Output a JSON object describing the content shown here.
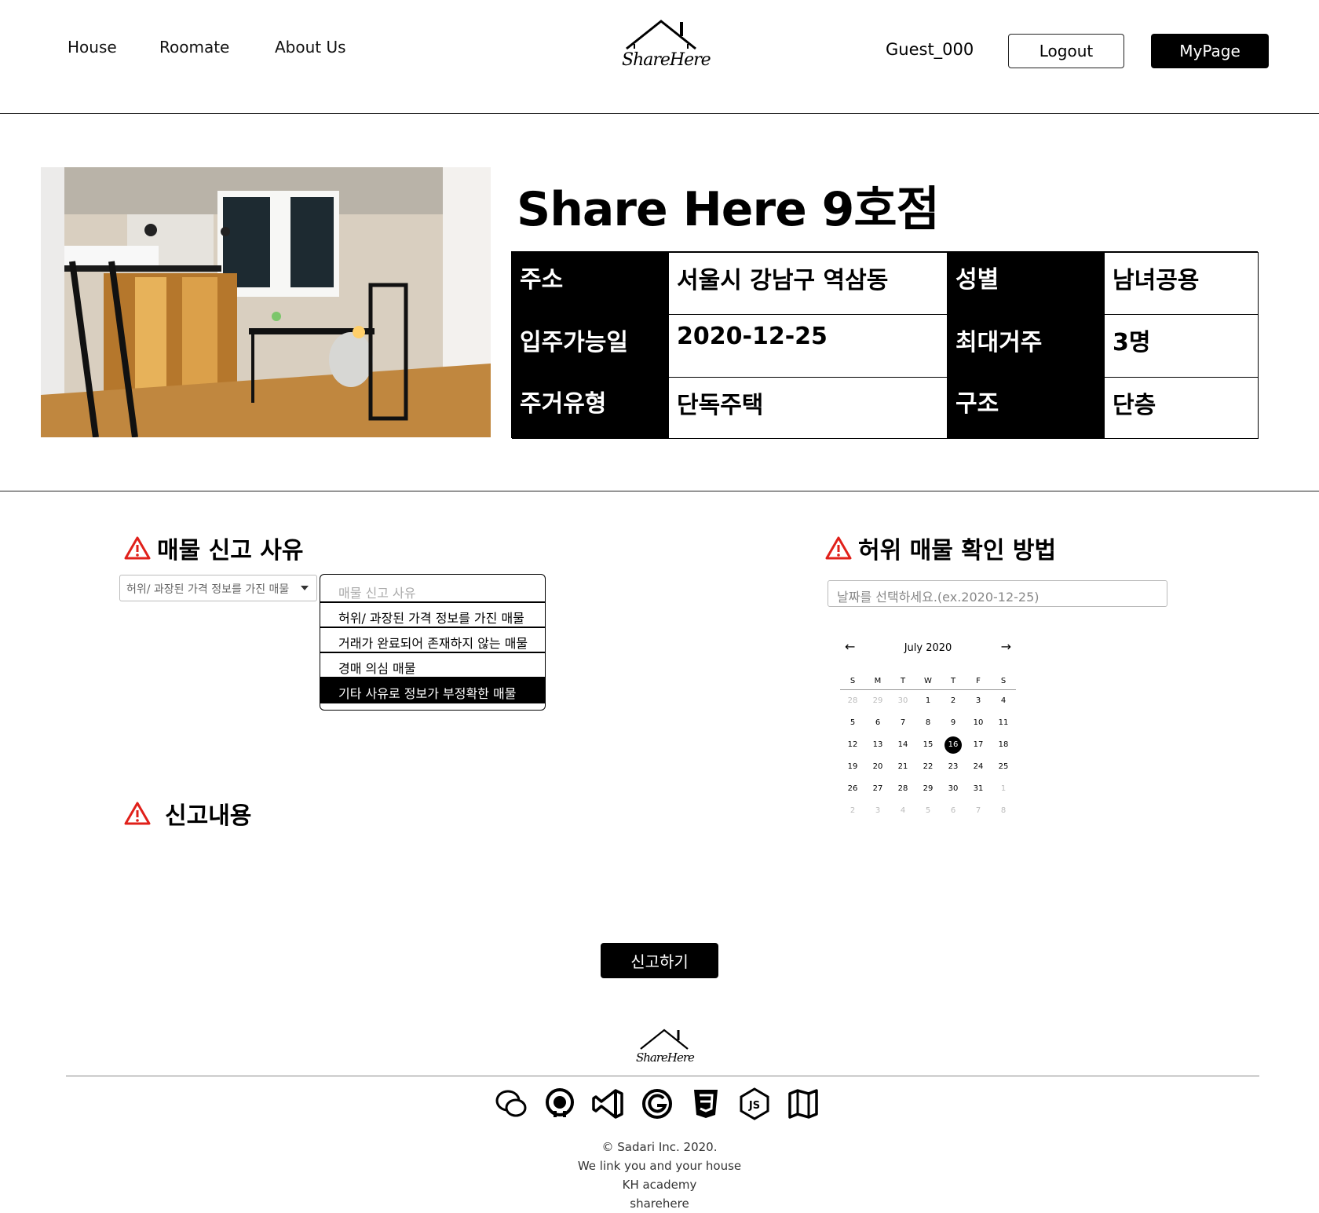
{
  "header": {
    "nav": [
      "House",
      "Roomate",
      "About Us"
    ],
    "logo_text": "ShareHere",
    "user": "Guest_000",
    "logout_label": "Logout",
    "mypage_label": "MyPage"
  },
  "listing": {
    "title": "Share Here 9호점",
    "fields": {
      "address_label": "주소",
      "address": "서울시 강남구 역삼동",
      "gender_label": "성별",
      "gender": "남녀공용",
      "movein_label": "입주가능일",
      "movein": "2020-12-25",
      "max_label": "최대거주",
      "max": "3명",
      "type_label": "주거유형",
      "type": "단독주택",
      "structure_label": "구조",
      "structure": "단층"
    }
  },
  "report": {
    "reason_heading": "매물 신고 사유",
    "select_value": "허위/ 과장된 가격 정보를 가진 매물",
    "dropdown_placeholder": "매물 신고 사유",
    "options": [
      "허위/ 과장된 가격 정보를 가진 매물",
      "거래가 완료되어 존재하지 않는 매물",
      "경매 의심 매물",
      "기타 사유로 정보가 부정확한 매물"
    ],
    "content_heading": "신고내용",
    "submit_label": "신고하기"
  },
  "verify": {
    "heading": "허위 매물 확인 방법",
    "date_placeholder": "날짜를 선택하세요.(ex.2020-12-25)",
    "calendar": {
      "month": "July 2020",
      "prev": "←",
      "next": "→",
      "dow": [
        "S",
        "M",
        "T",
        "W",
        "T",
        "F",
        "S"
      ],
      "weeks": [
        [
          "28",
          "29",
          "30",
          "1",
          "2",
          "3",
          "4"
        ],
        [
          "5",
          "6",
          "7",
          "8",
          "9",
          "10",
          "11"
        ],
        [
          "12",
          "13",
          "14",
          "15",
          "16",
          "17",
          "18"
        ],
        [
          "19",
          "20",
          "21",
          "22",
          "23",
          "24",
          "25"
        ],
        [
          "26",
          "27",
          "28",
          "29",
          "30",
          "31",
          "1"
        ],
        [
          "2",
          "3",
          "4",
          "5",
          "6",
          "7",
          "8"
        ]
      ],
      "selected": "16"
    }
  },
  "footer": {
    "logo_text": "ShareHere",
    "icons": [
      "chat-icon",
      "github-icon",
      "vscode-icon",
      "google-icon",
      "css3-icon",
      "nodejs-icon",
      "map-icon"
    ],
    "lines": [
      "© Sadari Inc. 2020.",
      "We link you and your house",
      "KH academy",
      "sharehere"
    ]
  },
  "colors": {
    "accent": "#000000",
    "warning": "#e0201a"
  }
}
